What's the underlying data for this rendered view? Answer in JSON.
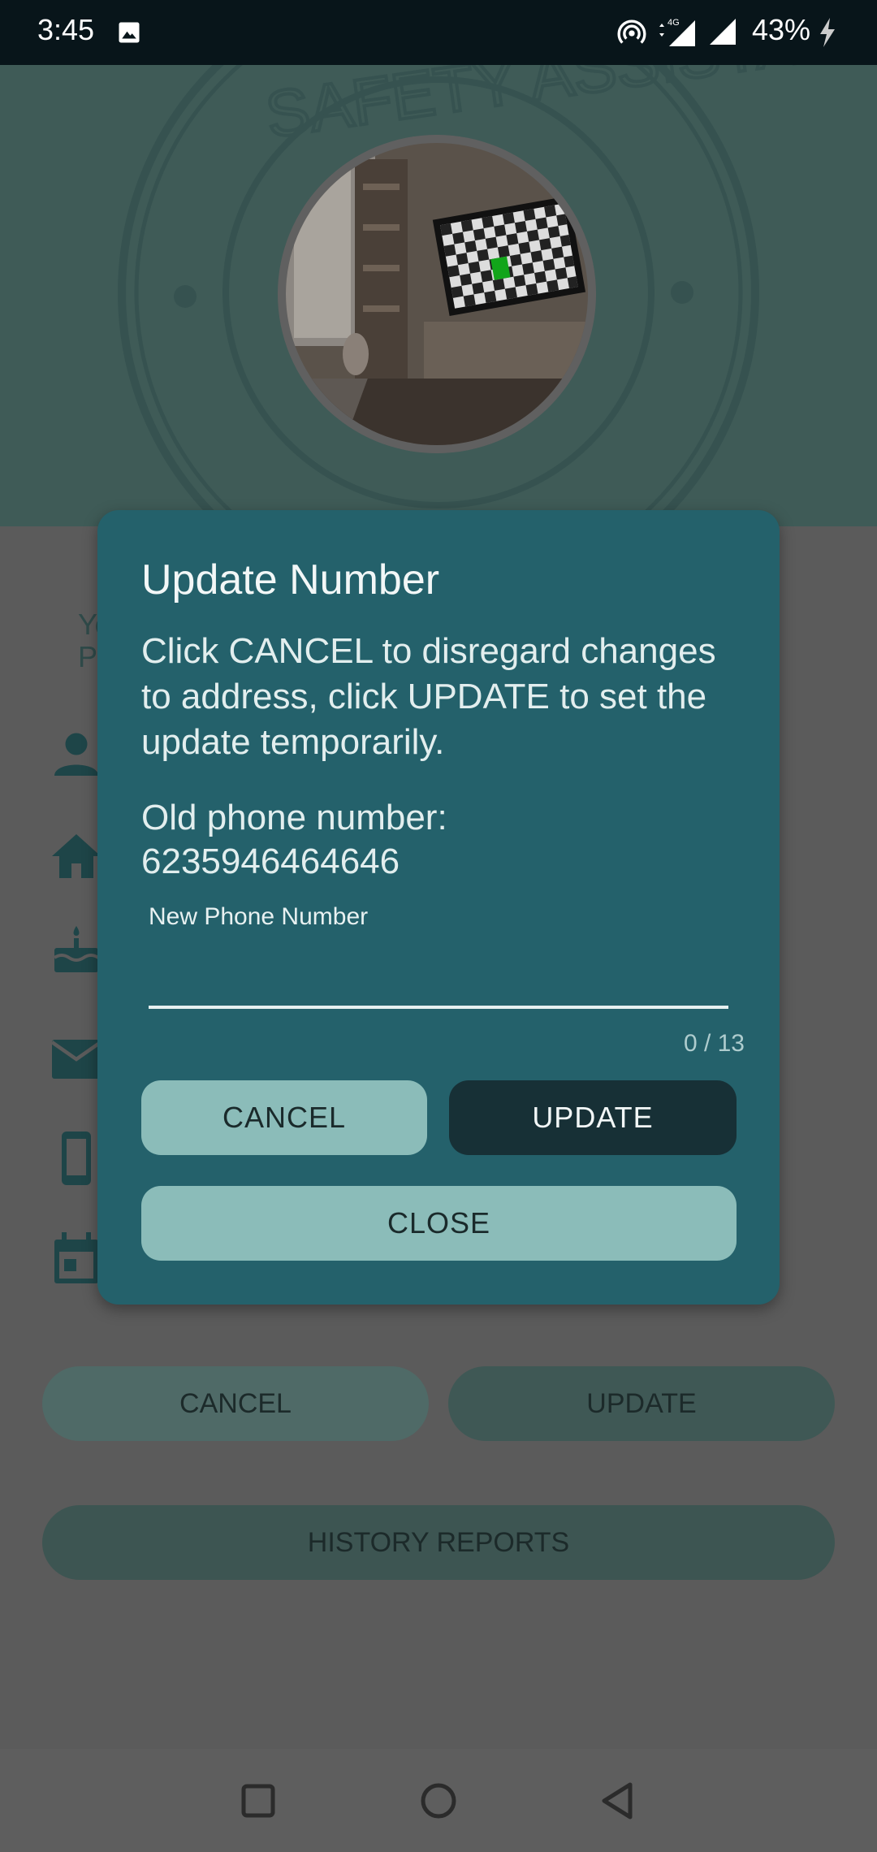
{
  "status_bar": {
    "time": "3:45",
    "battery": "43%",
    "network": "4G",
    "icons": [
      "image-icon",
      "hotspot-icon",
      "network-4g-icon",
      "signal-icon",
      "charging-icon"
    ]
  },
  "background": {
    "side_text_1": "Yo",
    "side_text_2": "P",
    "side_icons": [
      "person-icon",
      "home-icon",
      "cake-icon",
      "mail-icon",
      "phone-icon",
      "calendar-icon"
    ],
    "cancel_label": "CANCEL",
    "update_label": "UPDATE",
    "history_label": "HISTORY REPORTS"
  },
  "dialog": {
    "title": "Update Number",
    "message": "Click CANCEL to disregard changes to address, click UPDATE to set the update temporarily.",
    "old_number_label": "Old phone number:",
    "old_number_value": "6235946464646",
    "field_label": "New Phone Number",
    "field_value": "",
    "char_counter": "0 / 13",
    "cancel_label": "CANCEL",
    "update_label": "UPDATE",
    "close_label": "CLOSE"
  },
  "nav_bar": {
    "icons": [
      "recents-square-icon",
      "home-circle-icon",
      "back-triangle-icon"
    ]
  },
  "colors": {
    "dialog_bg": "#24616b",
    "light_button": "#8bbcb9",
    "dark_button": "#173036",
    "status_bar": "#08151a"
  }
}
